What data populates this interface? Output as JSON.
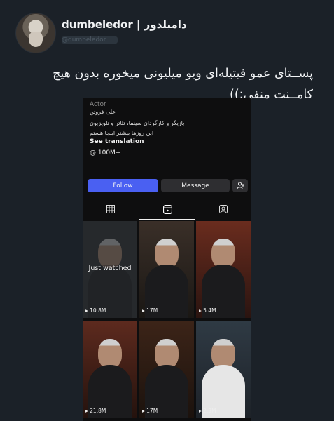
{
  "author": {
    "display_name": "dumbeledor | دامبلدور",
    "handle": "@dumbeledor"
  },
  "tweet": {
    "text": "پســتای عمو فیتیله‌ای ویو میلیونی میخوره بدون هیچ کامــنت منفی:))"
  },
  "profile": {
    "role": "Actor",
    "bio_lines": [
      "علی فروتن",
      "بازیگر و کارگردان سینما، تئاتر و تلویزیون",
      "این روزها بیشتر اینجا هستم"
    ],
    "see_translation": "See translation",
    "threads_count": "100M+",
    "follow_label": "Follow",
    "message_label": "Message",
    "icons": {
      "add_user": "add-person-icon",
      "threads": "threads-icon",
      "grid": "grid-icon",
      "reels": "reels-icon",
      "tagged": "tagged-icon",
      "eye": "play-count-icon"
    },
    "reels": [
      {
        "views": "10.8M",
        "overlay": "Just watched"
      },
      {
        "views": "17M"
      },
      {
        "views": "5.4M"
      },
      {
        "views": "21.8M"
      },
      {
        "views": "17M"
      },
      {
        "views": "2.3M"
      }
    ],
    "colors": {
      "follow": "#4a60f2",
      "secondary_button": "#2e2e31",
      "page_bg": "#1b2128"
    }
  }
}
